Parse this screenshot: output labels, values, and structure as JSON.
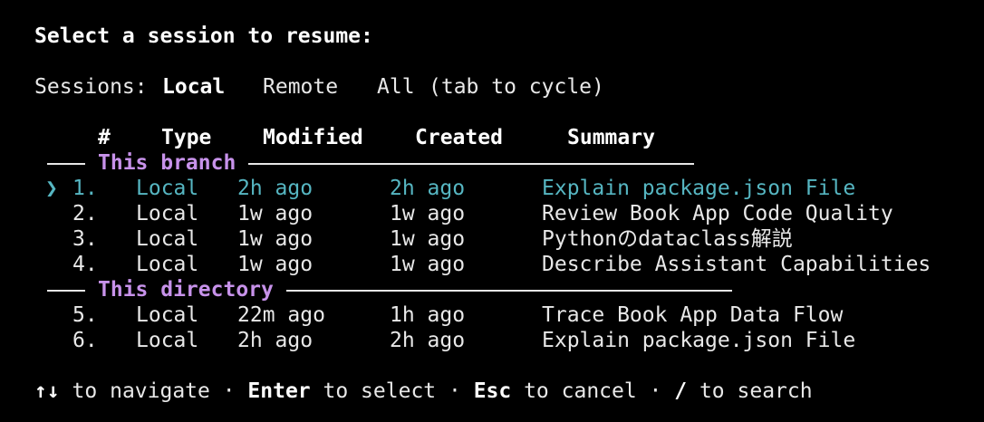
{
  "title": "Select a session to resume:",
  "sessions": {
    "label": "Sessions:",
    "tabs": [
      {
        "label": "Local",
        "active": true
      },
      {
        "label": "Remote",
        "active": false
      },
      {
        "label": "All",
        "active": false
      }
    ],
    "hint": "(tab to cycle)"
  },
  "columns": [
    "#",
    "Type",
    "Modified",
    "Created",
    "Summary"
  ],
  "groups": [
    {
      "label": "This branch",
      "rows": [
        {
          "num": "1.",
          "type": "Local",
          "modified": "2h ago",
          "created": "2h ago",
          "summary": "Explain package.json File",
          "selected": true
        },
        {
          "num": "2.",
          "type": "Local",
          "modified": "1w ago",
          "created": "1w ago",
          "summary": "Review Book App Code Quality",
          "selected": false
        },
        {
          "num": "3.",
          "type": "Local",
          "modified": "1w ago",
          "created": "1w ago",
          "summary": "Pythonのdataclass解説",
          "selected": false
        },
        {
          "num": "4.",
          "type": "Local",
          "modified": "1w ago",
          "created": "1w ago",
          "summary": "Describe Assistant Capabilities",
          "selected": false
        }
      ]
    },
    {
      "label": "This directory",
      "rows": [
        {
          "num": "5.",
          "type": "Local",
          "modified": "22m ago",
          "created": "1h ago",
          "summary": "Trace Book App Data Flow",
          "selected": false
        },
        {
          "num": "6.",
          "type": "Local",
          "modified": "2h ago",
          "created": "2h ago",
          "summary": "Explain package.json File",
          "selected": false
        }
      ]
    }
  ],
  "cursor_glyph": "❯",
  "footer": {
    "arrows": "↑↓",
    "navigate": " to navigate · ",
    "enter": "Enter",
    "select": " to select · ",
    "esc": "Esc",
    "cancel": " to cancel · ",
    "slash": "/",
    "search": " to search"
  },
  "colors": {
    "background": "#000000",
    "text": "#e8e8e8",
    "selected": "#56b6c2",
    "group_label": "#c792ea"
  }
}
